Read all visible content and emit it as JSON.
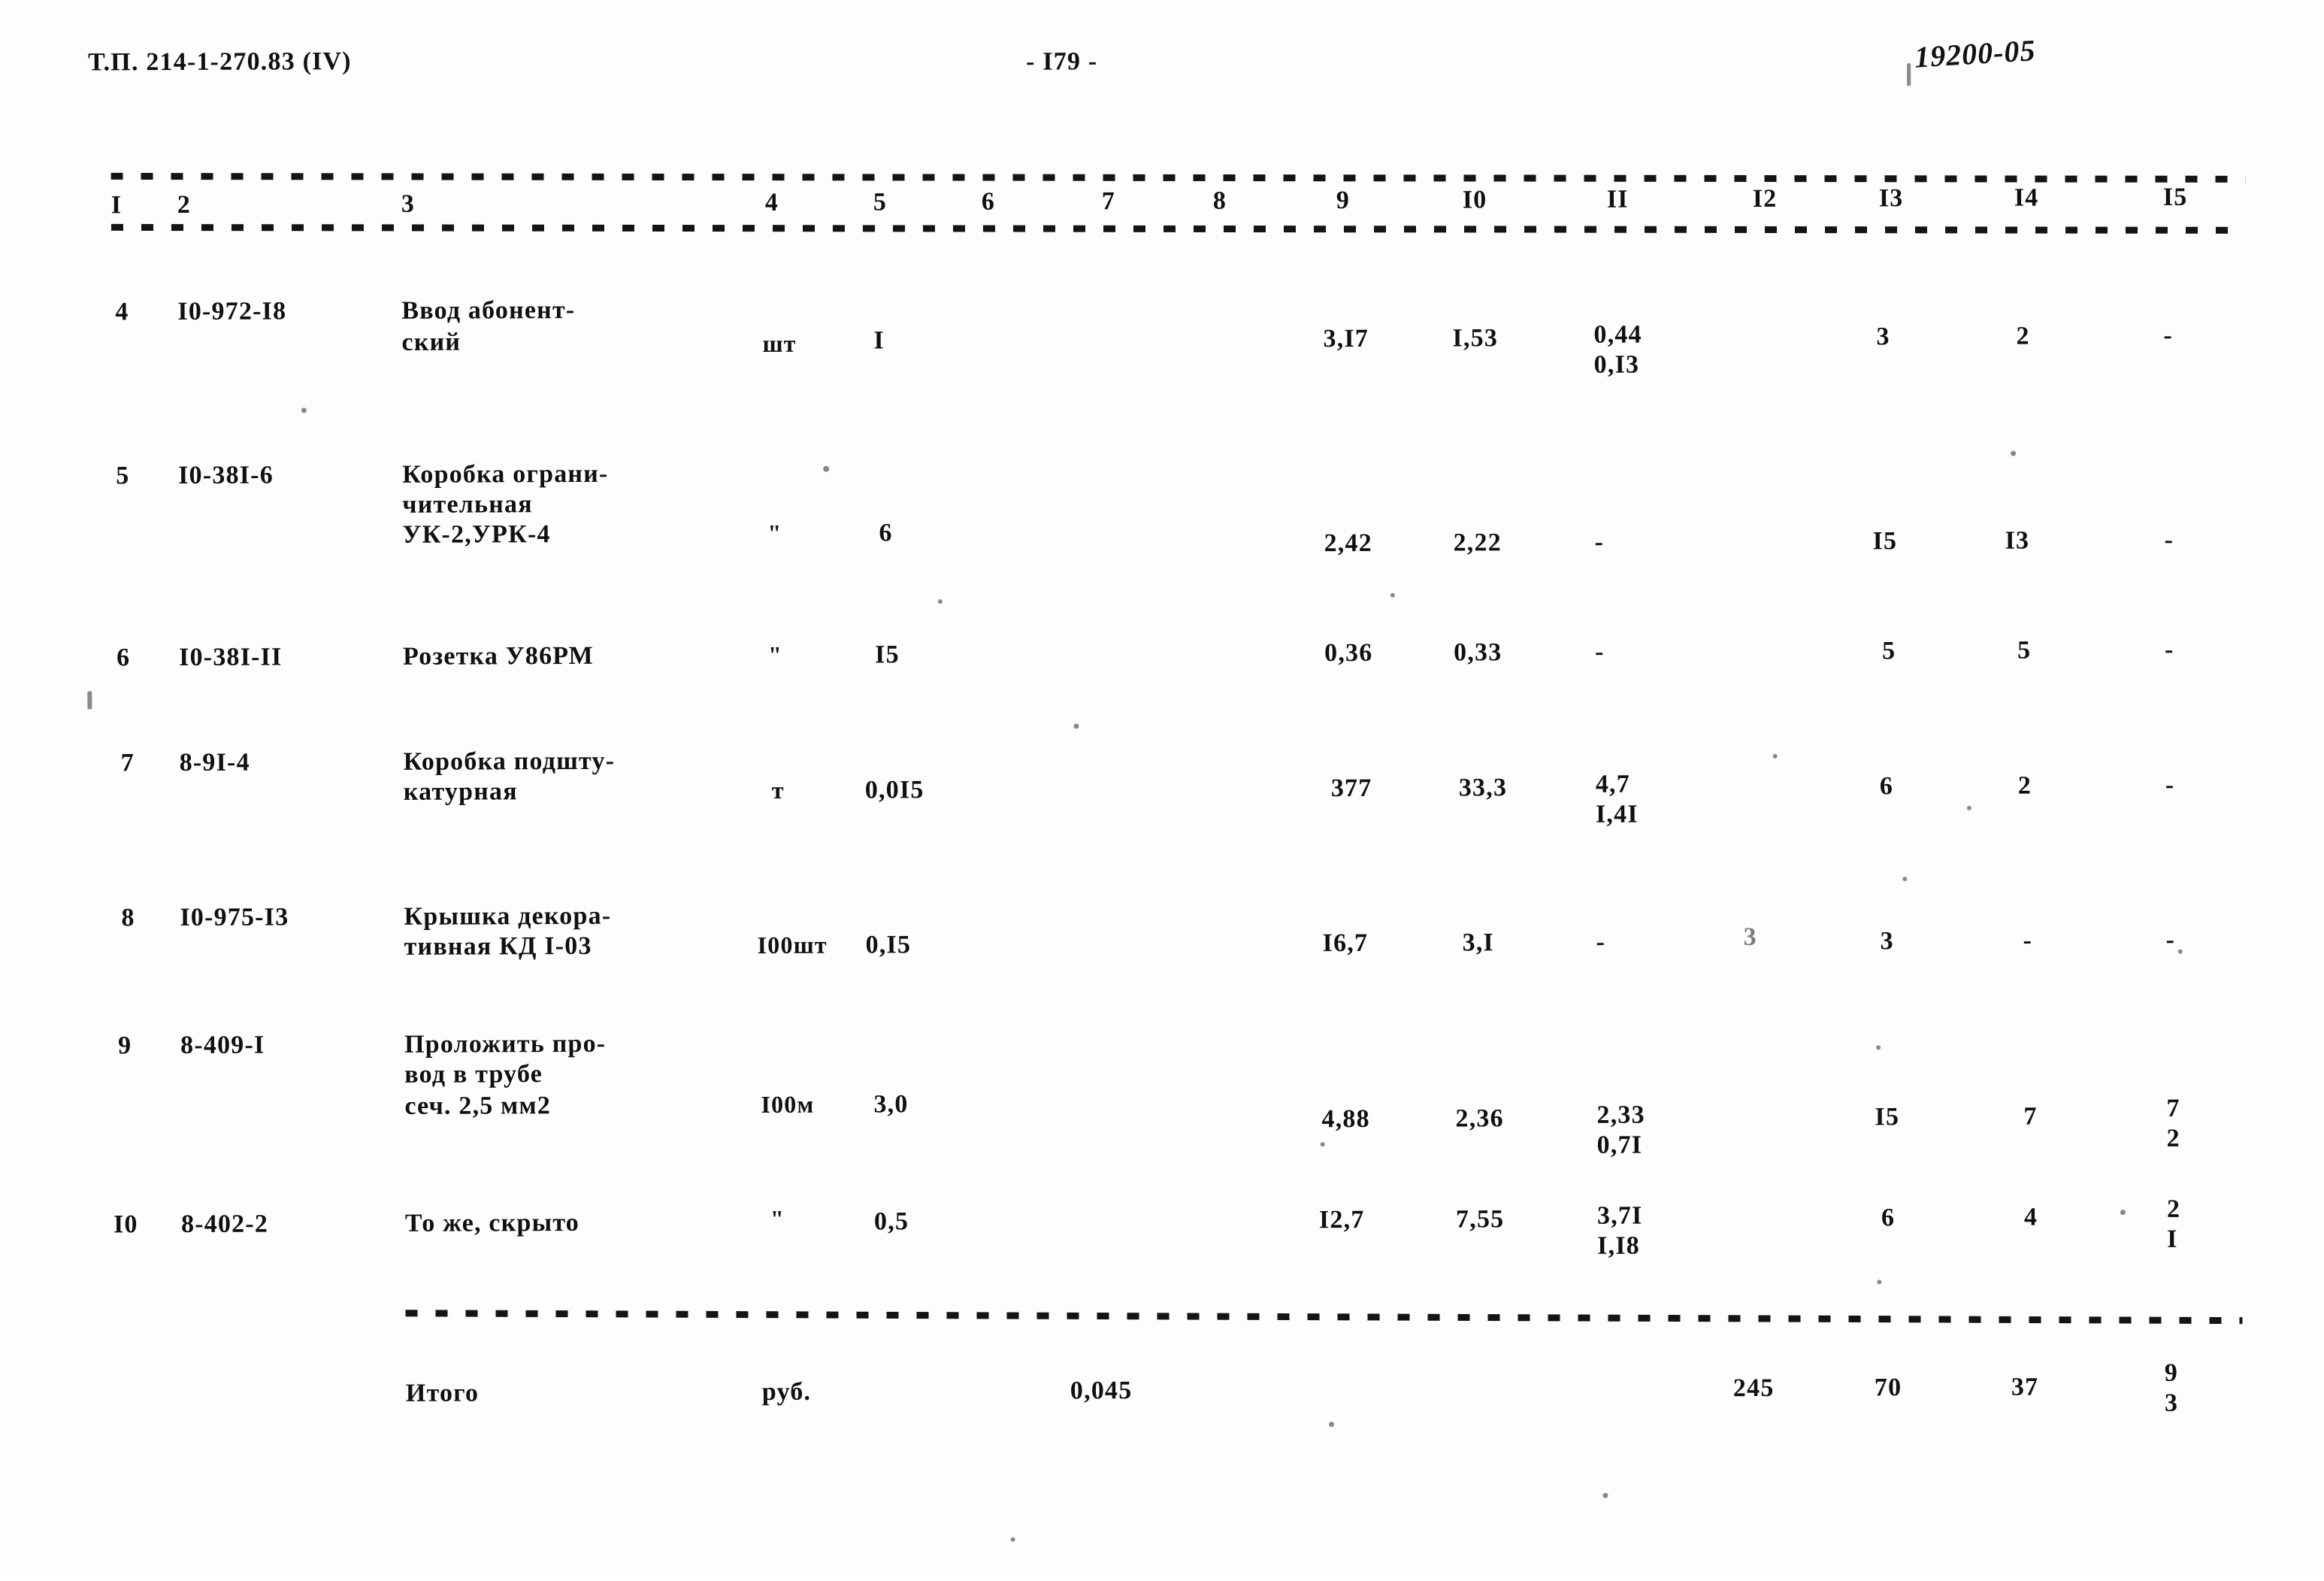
{
  "header": {
    "doc_code": "Т.П. 214-1-270.83 (IV)",
    "page_number": "- I79 -",
    "stamp": "19200-05"
  },
  "table": {
    "column_headers": [
      "I",
      "2",
      "3",
      "4",
      "5",
      "6",
      "7",
      "8",
      "9",
      "I0",
      "II",
      "I2",
      "I3",
      "I4",
      "I5"
    ],
    "rows": [
      {
        "c1": "4",
        "c2": "I0-972-I8",
        "c3_lines": [
          "Ввод абонент-",
          "ский"
        ],
        "c4": "шт",
        "c5": "I",
        "c6": "",
        "c7": "",
        "c8": "",
        "c9": "3,I7",
        "c10": "I,53",
        "c11_lines": [
          "0,44",
          "0,I3"
        ],
        "c12": "",
        "c13": "3",
        "c14": "2",
        "c15_lines": [
          "-"
        ]
      },
      {
        "c1": "5",
        "c2": "I0-38I-6",
        "c3_lines": [
          "Коробка ограни-",
          "чительная",
          "УК-2,УРК-4"
        ],
        "c4": "\"",
        "c5": "6",
        "c6": "",
        "c7": "",
        "c8": "",
        "c9": "2,42",
        "c10": "2,22",
        "c11_lines": [
          "-"
        ],
        "c12": "",
        "c13": "I5",
        "c14": "I3",
        "c15_lines": [
          "-"
        ]
      },
      {
        "c1": "6",
        "c2": "I0-38I-II",
        "c3_lines": [
          "Розетка У86РМ"
        ],
        "c4": "\"",
        "c5": "I5",
        "c6": "",
        "c7": "",
        "c8": "",
        "c9": "0,36",
        "c10": "0,33",
        "c11_lines": [
          "-"
        ],
        "c12": "",
        "c13": "5",
        "c14": "5",
        "c15_lines": [
          "-"
        ]
      },
      {
        "c1": "7",
        "c2": "8-9I-4",
        "c3_lines": [
          "Коробка подшту-",
          "катурная"
        ],
        "c4": "т",
        "c5": "0,0I5",
        "c6": "",
        "c7": "",
        "c8": "",
        "c9": "377",
        "c10": "33,3",
        "c11_lines": [
          "4,7",
          "I,4I"
        ],
        "c12": "",
        "c13": "6",
        "c14": "2",
        "c15_lines": [
          "-"
        ]
      },
      {
        "c1": "8",
        "c2": "I0-975-I3",
        "c3_lines": [
          "Крышка декора-",
          "тивная КД I-03"
        ],
        "c4": "I00шт",
        "c5": "0,I5",
        "c6": "",
        "c7": "",
        "c8": "",
        "c9": "I6,7",
        "c10": "3,I",
        "c11_lines": [
          "-"
        ],
        "c12": "3",
        "c13": "3",
        "c14": "-",
        "c15_lines": [
          "-"
        ]
      },
      {
        "c1": "9",
        "c2": "8-409-I",
        "c3_lines": [
          "Проложить про-",
          "вод в трубе",
          "сеч. 2,5 мм2"
        ],
        "c4": "I00м",
        "c5": "3,0",
        "c6": "",
        "c7": "",
        "c8": "",
        "c9": "4,88",
        "c10": "2,36",
        "c11_lines": [
          "2,33",
          "0,7I"
        ],
        "c12": "",
        "c13": "I5",
        "c14": "7",
        "c15_lines": [
          "7",
          "2"
        ]
      },
      {
        "c1": "I0",
        "c2": "8-402-2",
        "c3_lines": [
          "То же, скрыто"
        ],
        "c4": "\"",
        "c5": "0,5",
        "c6": "",
        "c7": "",
        "c8": "",
        "c9": "I2,7",
        "c10": "7,55",
        "c11_lines": [
          "3,7I",
          "I,I8"
        ],
        "c12": "",
        "c13": "6",
        "c14": "4",
        "c15_lines": [
          "2",
          "I"
        ]
      }
    ],
    "total_row": {
      "label": "Итого",
      "unit": "руб.",
      "c7": "0,045",
      "c12": "245",
      "c13": "70",
      "c14": "37",
      "c15_lines": [
        "9",
        "3"
      ]
    }
  }
}
